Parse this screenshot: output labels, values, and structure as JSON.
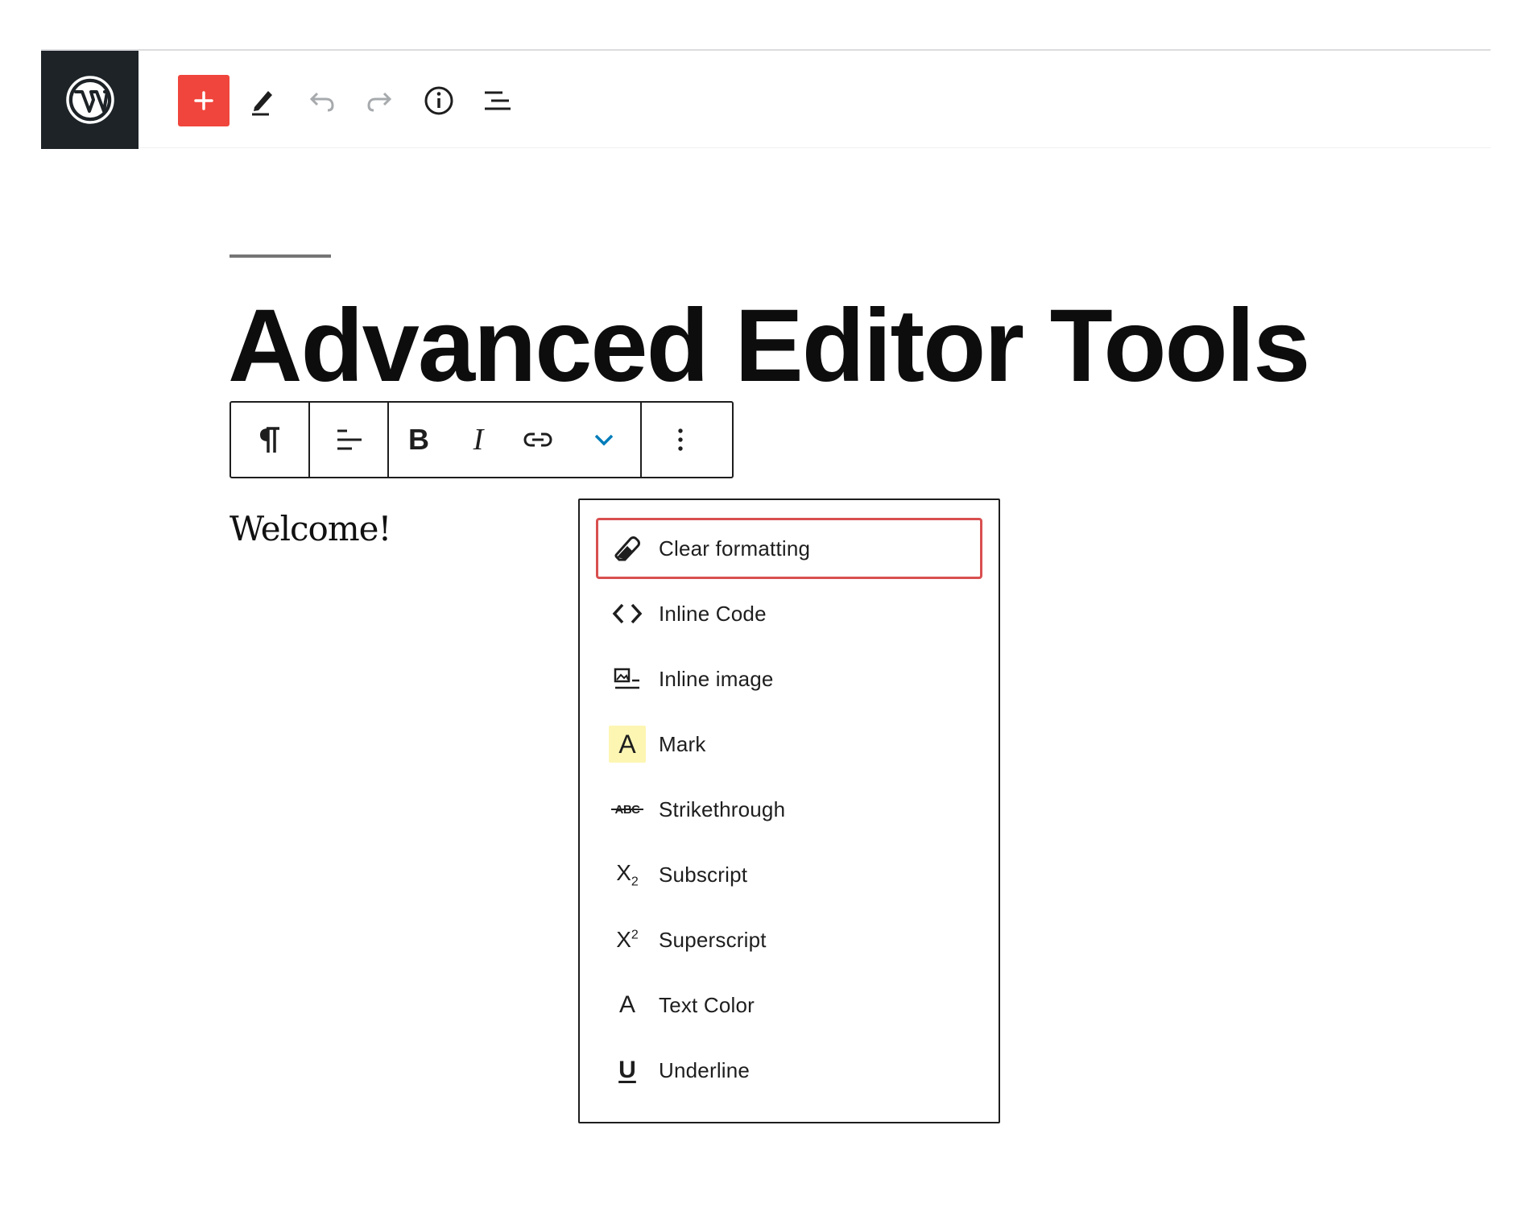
{
  "header": {
    "logo_icon": "wordpress-logo-icon",
    "tools": [
      {
        "name": "add-block-button",
        "icon": "plus-icon",
        "color": "#f0453c"
      },
      {
        "name": "tools-button",
        "icon": "pencil-icon"
      },
      {
        "name": "undo-button",
        "icon": "undo-icon"
      },
      {
        "name": "redo-button",
        "icon": "redo-icon"
      },
      {
        "name": "details-button",
        "icon": "info-icon"
      },
      {
        "name": "list-view-button",
        "icon": "list-view-icon"
      }
    ]
  },
  "editor": {
    "title": "Advanced Editor Tools",
    "paragraph": "Welcome!"
  },
  "block_toolbar": {
    "buttons": [
      {
        "icon": "paragraph-icon"
      },
      {
        "icon": "align-left-icon"
      },
      {
        "icon": "bold-icon",
        "glyph": "B"
      },
      {
        "icon": "italic-icon",
        "glyph": "I"
      },
      {
        "icon": "link-icon"
      },
      {
        "icon": "chevron-down-icon",
        "color": "#007cba"
      },
      {
        "icon": "more-vertical-icon"
      }
    ]
  },
  "format_menu": {
    "items": [
      {
        "label": "Clear formatting",
        "icon": "eraser-icon",
        "focused": true,
        "focus_color": "#d94f4f"
      },
      {
        "label": "Inline Code",
        "icon": "code-icon"
      },
      {
        "label": "Inline image",
        "icon": "inline-image-icon"
      },
      {
        "label": "Mark",
        "icon": "mark-icon",
        "glyph": "A",
        "highlight_color": "#fdf6b3"
      },
      {
        "label": "Strikethrough",
        "icon": "strikethrough-icon",
        "glyph": "ABC"
      },
      {
        "label": "Subscript",
        "icon": "subscript-icon",
        "glyph": "X",
        "sub": "2"
      },
      {
        "label": "Superscript",
        "icon": "superscript-icon",
        "glyph": "X",
        "sup": "2"
      },
      {
        "label": "Text Color",
        "icon": "text-color-icon",
        "glyph": "A"
      },
      {
        "label": "Underline",
        "icon": "underline-icon",
        "glyph": "U"
      }
    ]
  }
}
